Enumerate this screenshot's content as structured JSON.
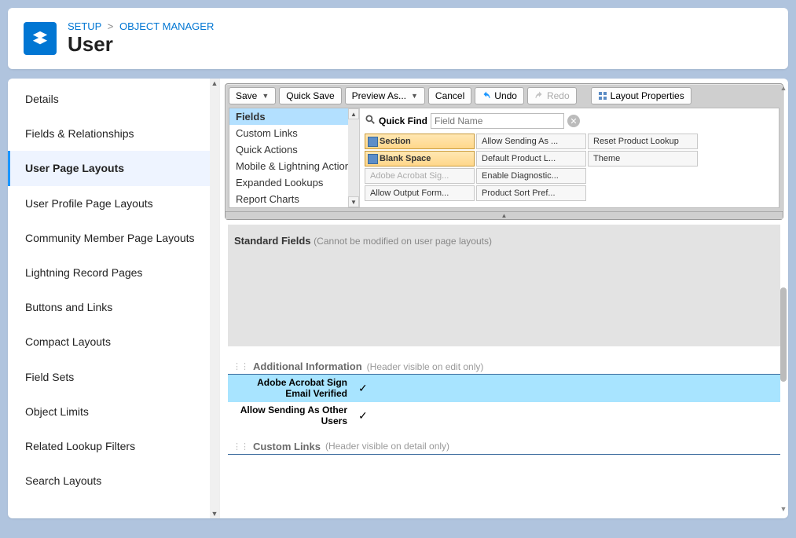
{
  "breadcrumb": {
    "p1": "SETUP",
    "p2": "OBJECT MANAGER"
  },
  "pageTitle": "User",
  "sidebar": {
    "items": [
      {
        "label": "Details"
      },
      {
        "label": "Fields & Relationships"
      },
      {
        "label": "User Page Layouts"
      },
      {
        "label": "User Profile Page Layouts"
      },
      {
        "label": "Community Member Page Layouts"
      },
      {
        "label": "Lightning Record Pages"
      },
      {
        "label": "Buttons and Links"
      },
      {
        "label": "Compact Layouts"
      },
      {
        "label": "Field Sets"
      },
      {
        "label": "Object Limits"
      },
      {
        "label": "Related Lookup Filters"
      },
      {
        "label": "Search Layouts"
      }
    ],
    "activeIndex": 2
  },
  "toolbar": {
    "save": "Save",
    "quickSave": "Quick Save",
    "previewAs": "Preview As...",
    "cancel": "Cancel",
    "undo": "Undo",
    "redo": "Redo",
    "layoutProps": "Layout Properties"
  },
  "palette": {
    "categories": [
      "Fields",
      "Custom Links",
      "Quick Actions",
      "Mobile & Lightning Actions",
      "Expanded Lookups",
      "Report Charts"
    ],
    "selectedCategory": 0,
    "quickFindLabel": "Quick Find",
    "quickFindPlaceholder": "Field Name",
    "chips": [
      {
        "label": "Section",
        "special": true
      },
      {
        "label": "Allow Sending As ..."
      },
      {
        "label": "Reset Product Lookup"
      },
      {
        "label": "Blank Space",
        "special": true
      },
      {
        "label": "Default Product L..."
      },
      {
        "label": "Theme"
      },
      {
        "label": "Adobe Acrobat Sig...",
        "used": true
      },
      {
        "label": "Enable Diagnostic..."
      },
      {
        "label": "Allow Output Form..."
      },
      {
        "label": "Product Sort Pref..."
      }
    ]
  },
  "canvas": {
    "standardFields": {
      "title": "Standard Fields",
      "note": "(Cannot be modified on user page layouts)"
    },
    "additionalInfo": {
      "title": "Additional Information",
      "note": "(Header visible on edit only)",
      "rows": [
        {
          "label": "Adobe Acrobat Sign Email Verified",
          "check": true,
          "highlight": true
        },
        {
          "label": "Allow Sending As Other Users",
          "check": true
        }
      ]
    },
    "customLinks": {
      "title": "Custom Links",
      "note": "(Header visible on detail only)"
    }
  }
}
